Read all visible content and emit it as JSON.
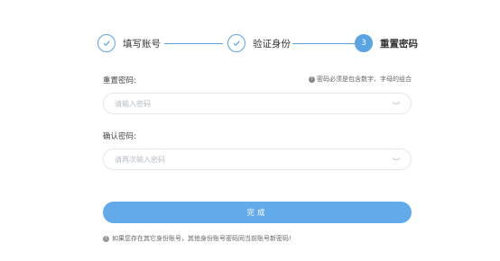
{
  "steps": [
    {
      "label": "填写账号",
      "status": "done",
      "icon": "check-icon"
    },
    {
      "label": "验证身份",
      "status": "done",
      "icon": "check-icon"
    },
    {
      "label": "重置密码",
      "status": "active",
      "number": "3"
    }
  ],
  "form": {
    "password_label": "重置密码:",
    "password_hint": "密码必须是包含数字、字母的组合",
    "password_placeholder": "请输入密码",
    "confirm_label": "确认密码:",
    "confirm_placeholder": "请再次输入密码",
    "submit_label": "完成"
  },
  "footer": {
    "note": "如果您存在其它身份账号，其他身份账号密码同当前账号新密码!"
  },
  "colors": {
    "accent": "#5aa4e6",
    "button": "#62aae9",
    "border": "#e3e7ec"
  }
}
